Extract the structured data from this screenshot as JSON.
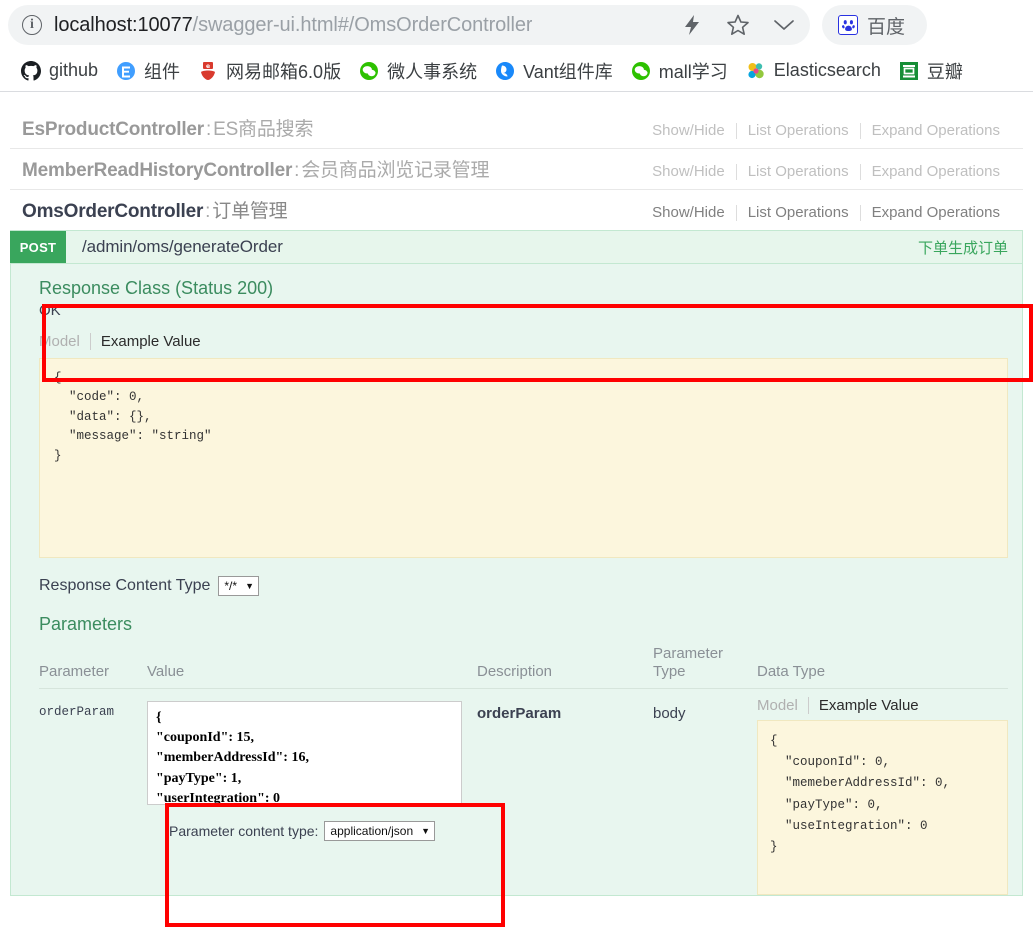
{
  "browser": {
    "url_host": "localhost:10077",
    "url_path": "/swagger-ui.html#/OmsOrderController",
    "actions": {
      "bolt": "bolt-icon",
      "star": "star-icon",
      "chevron": "chevron-down-icon"
    },
    "side_bookmark": {
      "label": "百度",
      "icon": "baidu-icon"
    },
    "bookmarks": [
      {
        "label": "github",
        "icon": "github-icon",
        "color": "#1b1f23"
      },
      {
        "label": "组件",
        "icon": "element-icon",
        "color": "#409eff"
      },
      {
        "label": "网易邮箱6.0版",
        "icon": "netease-icon",
        "color": "#d93a2e"
      },
      {
        "label": "微人事系统",
        "icon": "wechat-icon",
        "color": "#2dc100"
      },
      {
        "label": "Vant组件库",
        "icon": "vant-icon",
        "color": "#1989fa"
      },
      {
        "label": "mall学习",
        "icon": "wechat-icon",
        "color": "#2dc100"
      },
      {
        "label": "Elasticsearch",
        "icon": "elasticsearch-icon",
        "color": "#f0bf1a"
      },
      {
        "label": "豆瓣",
        "icon": "douban-icon",
        "color": "#168e36"
      }
    ]
  },
  "resources": [
    {
      "name": "EsProductController",
      "description": "ES商品搜索",
      "show_hide": "Show/Hide",
      "list_operations": "List Operations",
      "expand_operations": "Expand Operations"
    },
    {
      "name": "MemberReadHistoryController",
      "description": "会员商品浏览记录管理",
      "show_hide": "Show/Hide",
      "list_operations": "List Operations",
      "expand_operations": "Expand Operations"
    },
    {
      "name": "OmsOrderController",
      "description": "订单管理",
      "show_hide": "Show/Hide",
      "list_operations": "List Operations",
      "expand_operations": "Expand Operations"
    }
  ],
  "operation": {
    "method": "POST",
    "path": "/admin/oms/generateOrder",
    "summary": "下单生成订单",
    "response_class_title": "Response Class (Status 200)",
    "response_status_text": "OK",
    "tabs": {
      "model": "Model",
      "example": "Example Value"
    },
    "response_example": "{\n  \"code\": 0,\n  \"data\": {},\n  \"message\": \"string\"\n}",
    "response_content_type_label": "Response Content Type",
    "response_content_type_value": "*/*"
  },
  "parameters_section": {
    "title": "Parameters",
    "headers": {
      "parameter": "Parameter",
      "value": "Value",
      "description": "Description",
      "parameter_type": "Parameter\nType",
      "data_type": "Data Type"
    },
    "row": {
      "name": "orderParam",
      "value": "{\n\"couponId\": 15,\n\"memberAddressId\": 16,\n\"payType\": 1,\n\"userIntegration\": 0\n}",
      "description": "orderParam",
      "parameter_type": "body",
      "data_type_tabs": {
        "model": "Model",
        "example": "Example Value"
      },
      "data_type_example": "{\n  \"couponId\": 0,\n  \"memeberAddressId\": 0,\n  \"payType\": 0,\n  \"useIntegration\": 0\n}"
    },
    "content_type_label": "Parameter content type:",
    "content_type_value": "application/json"
  },
  "colors": {
    "method_post": "#39a65d",
    "accent_green": "#3b8c5f",
    "panel_bg": "#e8f6ef",
    "code_bg": "#fcf6dd",
    "annotation_red": "#ff0000"
  }
}
